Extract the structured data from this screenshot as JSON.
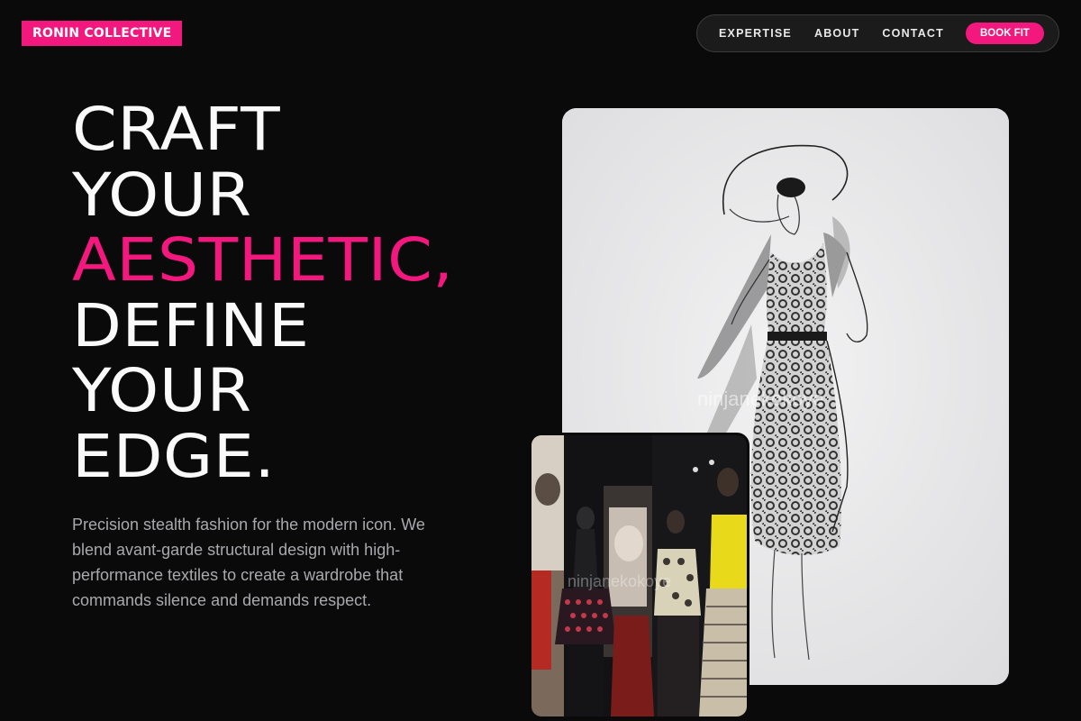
{
  "header": {
    "logo_text": "RONIN COLLECTIVE",
    "nav": [
      {
        "label": "EXPERTISE"
      },
      {
        "label": "ABOUT"
      },
      {
        "label": "CONTACT"
      }
    ],
    "cta_label": "BOOK FIT"
  },
  "hero": {
    "title_lines": [
      "CRAFT",
      "YOUR",
      "AESTHETIC,",
      "DEFINE",
      "YOUR",
      "EDGE."
    ],
    "accent_line_index": 2,
    "description": "Precision stealth fashion for the modern icon. We blend avant-garde structural design with high-performance textiles to create a wardrobe that commands silence and demands respect."
  },
  "images": {
    "sketch_watermark": "ninjanekokoye",
    "photo_watermark": "ninjanekokoye"
  },
  "colors": {
    "accent": "#f2187e",
    "background": "#0b0a0b",
    "nav_bg": "#1b1b1c",
    "muted_text": "#a9a9ad"
  }
}
